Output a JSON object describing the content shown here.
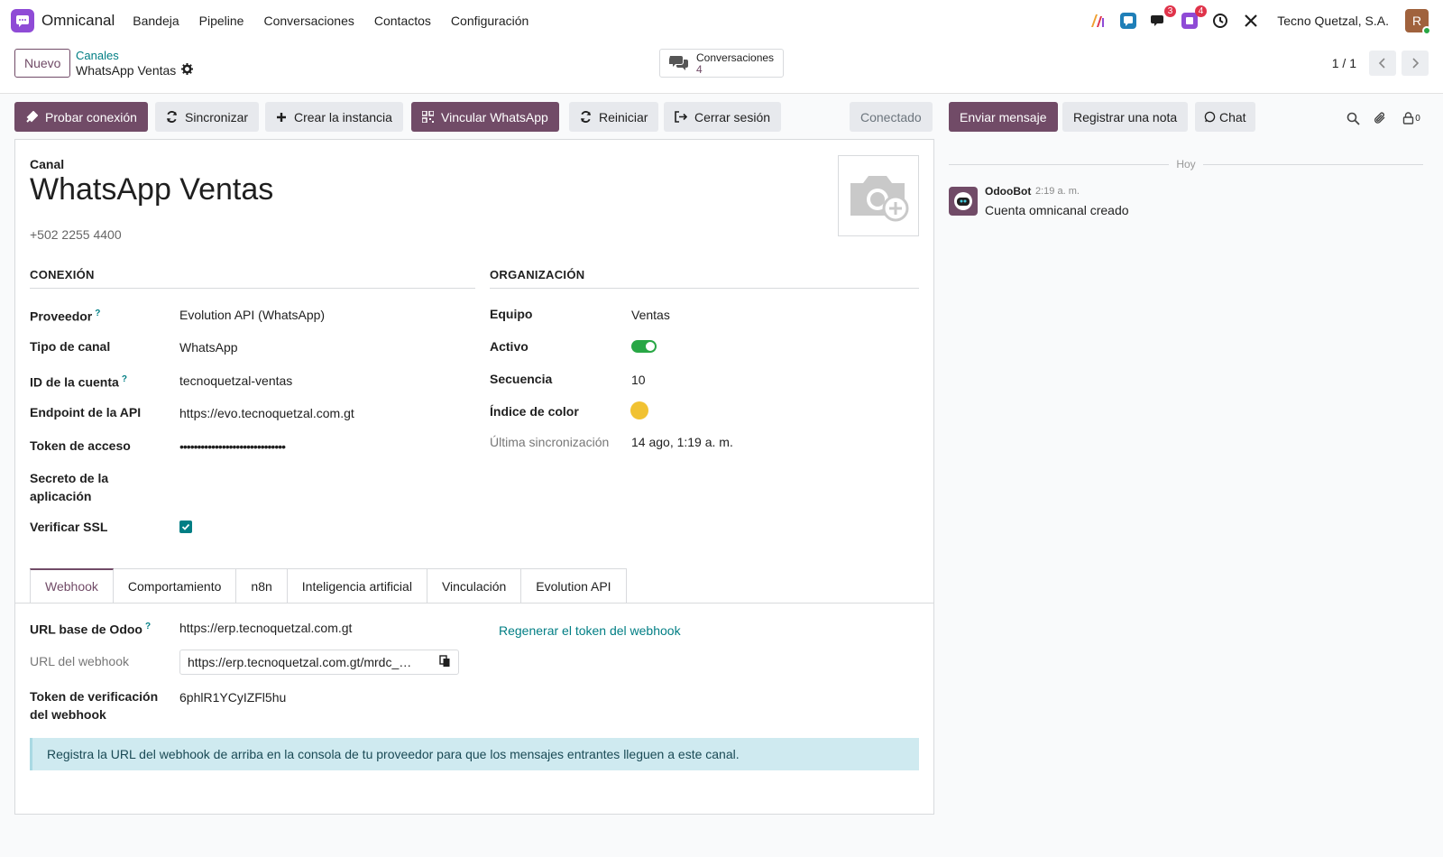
{
  "navbar": {
    "app_name": "Omnicanal",
    "menu": [
      "Bandeja",
      "Pipeline",
      "Conversaciones",
      "Contactos",
      "Configuración"
    ],
    "discuss_badge": "3",
    "activity_badge": "4",
    "company": "Tecno Quetzal, S.A.",
    "user_initial": "R"
  },
  "control_panel": {
    "new_label": "Nuevo",
    "breadcrumb_parent": "Canales",
    "breadcrumb_current": "WhatsApp Ventas",
    "smart_button": {
      "label": "Conversaciones",
      "count": "4"
    },
    "pager_value": "1 / 1"
  },
  "statusbar": {
    "buttons": [
      "Probar conexión",
      "Sincronizar",
      "Crear la instancia",
      "Vincular WhatsApp",
      "Reiniciar",
      "Cerrar sesión"
    ],
    "state": "Conectado"
  },
  "chatter_buttons": {
    "send": "Enviar mensaje",
    "note": "Registrar una nota",
    "chat": "Chat",
    "followers_count": "0"
  },
  "form": {
    "name_label": "Canal",
    "name": "WhatsApp Ventas",
    "phone": "+502 2255 4400",
    "connection": {
      "title": "CONEXIÓN",
      "provider_label": "Proveedor",
      "provider": "Evolution API (WhatsApp)",
      "type_label": "Tipo de canal",
      "type": "WhatsApp",
      "account_label": "ID de la cuenta",
      "account": "tecnoquetzal-ventas",
      "endpoint_label": "Endpoint de la API",
      "endpoint": "https://evo.tecnoquetzal.com.gt",
      "token_label": "Token de acceso",
      "token": "••••••••••••••••••••••••••••••",
      "secret_label_1": "Secreto de la",
      "secret_label_2": "aplicación",
      "ssl_label": "Verificar SSL",
      "ssl_checked": true
    },
    "organization": {
      "title": "ORGANIZACIÓN",
      "team_label": "Equipo",
      "team": "Ventas",
      "active_label": "Activo",
      "active": true,
      "sequence_label": "Secuencia",
      "sequence": "10",
      "color_label": "Índice de color",
      "color": "#f1c232",
      "last_sync_label": "Última sincronización",
      "last_sync": "14 ago, 1:19 a. m."
    },
    "tabs": [
      "Webhook",
      "Comportamiento",
      "n8n",
      "Inteligencia artificial",
      "Vinculación",
      "Evolution API"
    ],
    "webhook": {
      "base_url_label": "URL base de Odoo",
      "base_url": "https://erp.tecnoquetzal.com.gt",
      "regen_link": "Regenerar el token del webhook",
      "url_label": "URL del webhook",
      "url": "https://erp.tecnoquetzal.com.gt/mrdc_…",
      "verify_label_1": "Token de verificación",
      "verify_label_2": "del webhook",
      "verify_token": "6phlR1YCyIZFl5hu",
      "info": "Registra la URL del webhook de arriba en la consola de tu proveedor para que los mensajes entrantes lleguen a este canal."
    }
  },
  "chatter": {
    "date_separator": "Hoy",
    "message": {
      "author": "OdooBot",
      "time": "2:19 a. m.",
      "body": "Cuenta omnicanal creado"
    }
  },
  "colors": {
    "brand": "#714b67",
    "link": "#017e84",
    "toggle_on": "#28a745"
  }
}
